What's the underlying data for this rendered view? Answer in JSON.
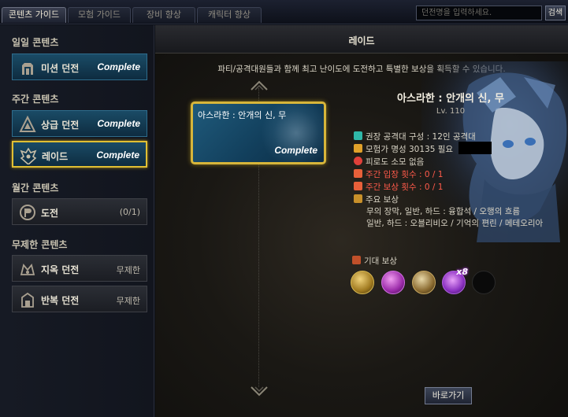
{
  "tabs": [
    {
      "label": "콘텐츠 가이드",
      "active": true
    },
    {
      "label": "모험 가이드",
      "active": false
    },
    {
      "label": "장비 향상",
      "active": false
    },
    {
      "label": "캐릭터 향상",
      "active": false
    }
  ],
  "search": {
    "placeholder": "던전명을 입력하세요.",
    "button_label": "검색"
  },
  "sidebar": {
    "sections": [
      {
        "title": "일일 콘텐츠"
      },
      {
        "title": "주간 콘텐츠"
      },
      {
        "title": "월간 콘텐츠"
      },
      {
        "title": "무제한 콘텐츠"
      }
    ],
    "items": [
      {
        "label": "미션 던전",
        "status": "Complete",
        "icon": "mission-dungeon-icon"
      },
      {
        "label": "상급 던전",
        "status": "Complete",
        "icon": "advanced-dungeon-icon"
      },
      {
        "label": "레이드",
        "status": "Complete",
        "icon": "raid-icon"
      },
      {
        "label": "도전",
        "status": "(0/1)",
        "icon": "challenge-icon"
      },
      {
        "label": "지옥 던전",
        "status": "무제한",
        "icon": "hell-dungeon-icon"
      },
      {
        "label": "반복 던전",
        "status": "무제한",
        "icon": "repeat-dungeon-icon"
      }
    ]
  },
  "main": {
    "title": "레이드",
    "description": "파티/공격대원들과 함께 최고 난이도에 도전하고 특별한 보상을 획득할 수 있습니다.",
    "raid_card": {
      "name": "아스라한 : 안개의 신, 무",
      "status": "Complete"
    },
    "info": {
      "title": "아스라한 : 안개의 신, 무",
      "level": "Lv. 110",
      "rows": [
        {
          "text": "권장 공격대 구성 : 12인 공격대",
          "icon": "party-icon",
          "color": "#2fb7a8"
        },
        {
          "text": "모험가 명성 30135 필요",
          "icon": "fame-icon",
          "color": "#e0a12a"
        },
        {
          "text": "피로도 소모 없음",
          "icon": "fatigue-icon",
          "color": "#e0403a"
        },
        {
          "text": "주간 입장 횟수 : 0 / 1",
          "icon": "entry-count-icon",
          "color": "#e8603a",
          "warn": true
        },
        {
          "text": "주간 보상 횟수 : 0 / 1",
          "icon": "reward-count-icon",
          "color": "#e8603a",
          "warn": true
        },
        {
          "text": "주요 보상",
          "icon": "main-reward-icon",
          "color": "#c8902a"
        }
      ],
      "reward_lines": [
        "무의 장막, 일반, 하드 : 융합석 / 오행의 흐름",
        "일반, 하드 : 오블리비오 / 기억의 편린 / 메테오리아"
      ]
    },
    "expected_reward": {
      "title": "기대 보상",
      "items": [
        {
          "icon": "fusion-stone-gold-icon",
          "count": ""
        },
        {
          "icon": "fusion-stone-purple-icon",
          "count": ""
        },
        {
          "icon": "material-bundle-icon",
          "count": ""
        },
        {
          "icon": "purple-crystal-icon",
          "count": "x8"
        },
        {
          "icon": "empty-slot-icon",
          "count": ""
        }
      ]
    },
    "go_button": "바로가기"
  }
}
